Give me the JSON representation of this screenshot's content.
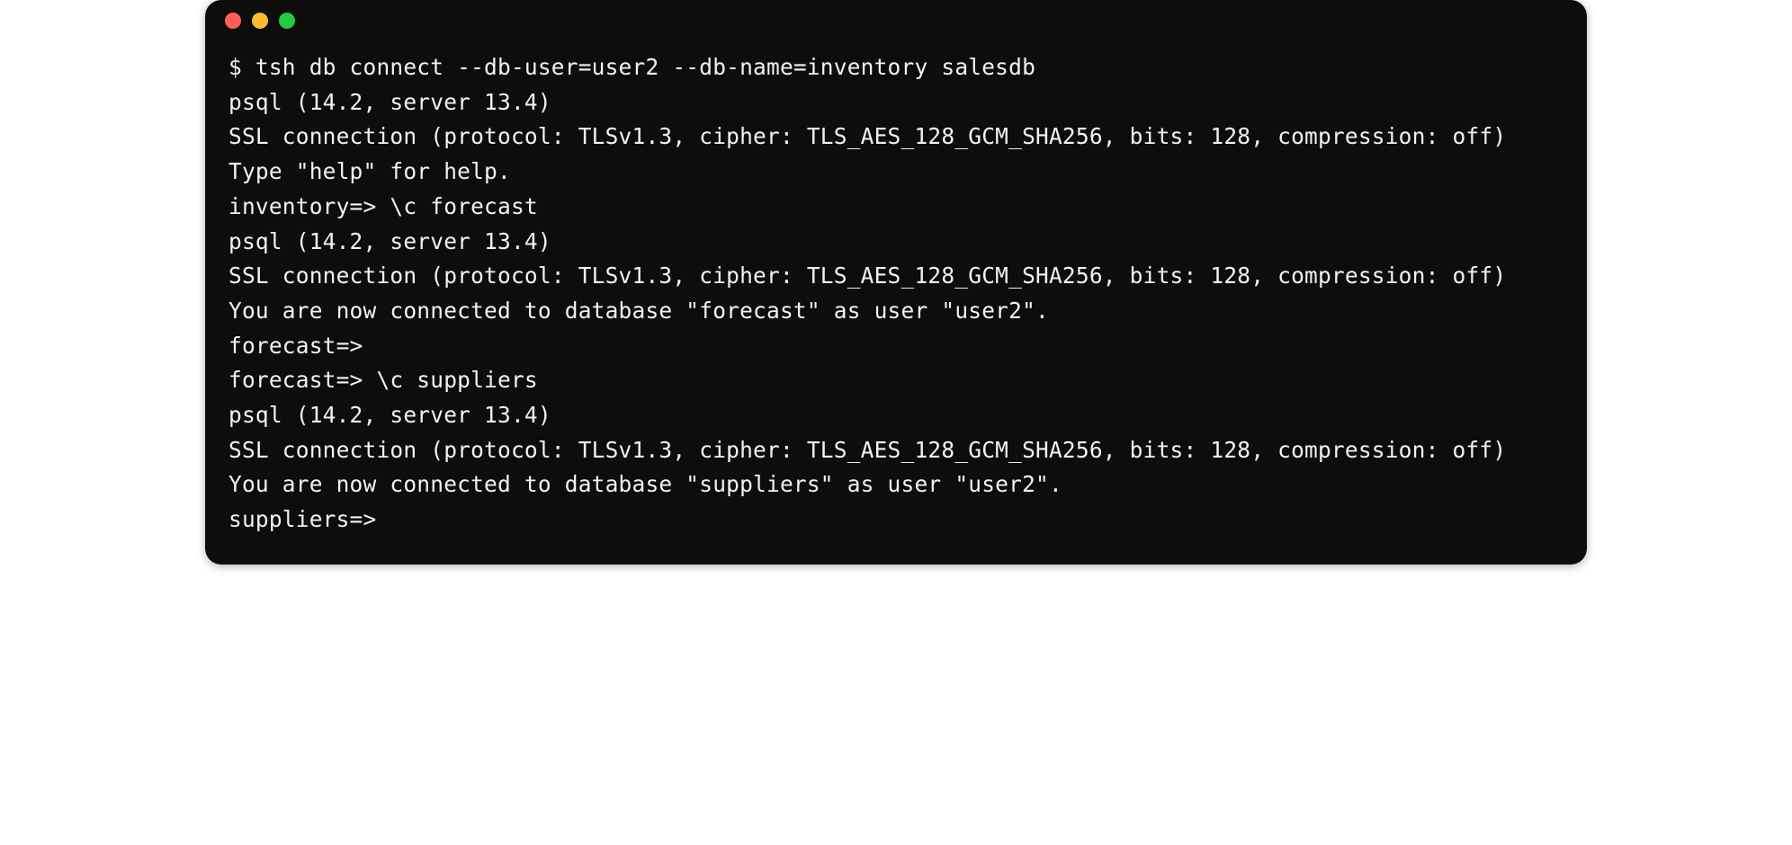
{
  "titlebar": {
    "buttons": [
      "close",
      "minimize",
      "maximize"
    ]
  },
  "lines": [
    "$ tsh db connect --db-user=user2 --db-name=inventory salesdb",
    "psql (14.2, server 13.4)",
    "SSL connection (protocol: TLSv1.3, cipher: TLS_AES_128_GCM_SHA256, bits: 128, compression: off)",
    "Type \"help\" for help.",
    "",
    "inventory=> \\c forecast",
    "psql (14.2, server 13.4)",
    "SSL connection (protocol: TLSv1.3, cipher: TLS_AES_128_GCM_SHA256, bits: 128, compression: off)",
    "You are now connected to database \"forecast\" as user \"user2\".",
    "forecast=>",
    "forecast=> \\c suppliers",
    "psql (14.2, server 13.4)",
    "SSL connection (protocol: TLSv1.3, cipher: TLS_AES_128_GCM_SHA256, bits: 128, compression: off)",
    "You are now connected to database \"suppliers\" as user \"user2\".",
    "suppliers=>"
  ]
}
